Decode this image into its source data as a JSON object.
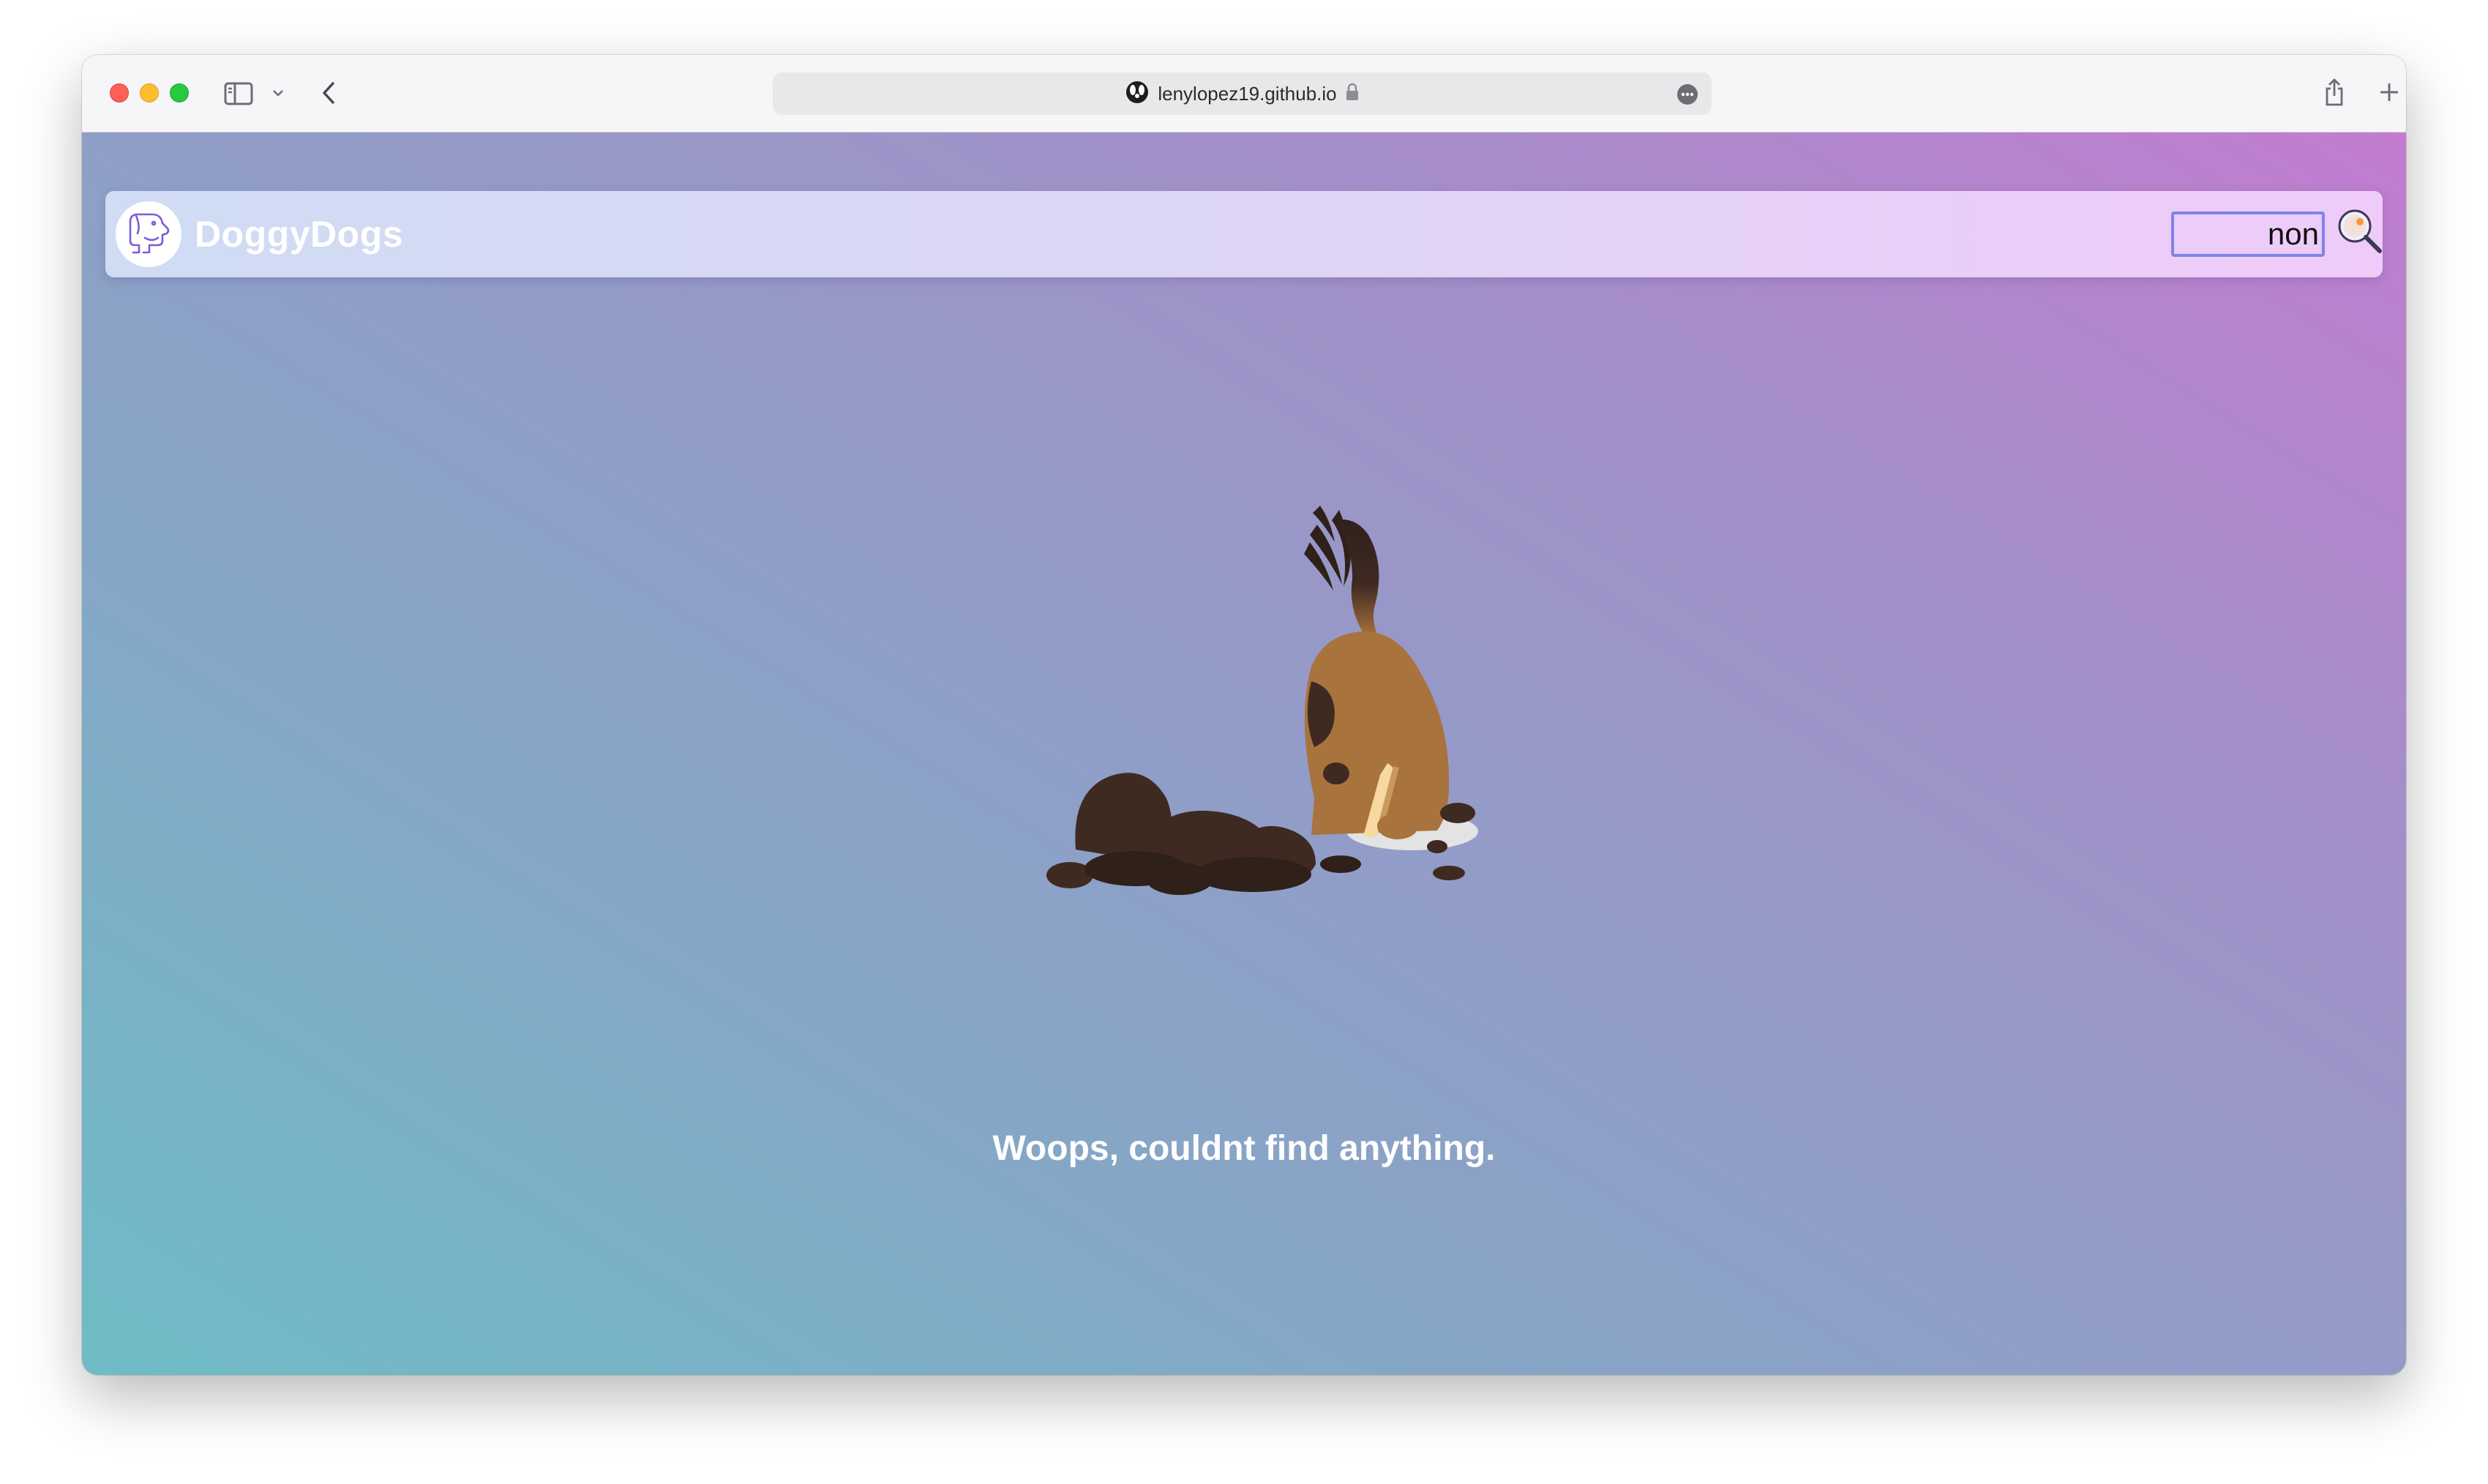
{
  "browser": {
    "url": "lenylopez19.github.io",
    "icons": {
      "sidebar": "sidebar-icon",
      "chevron": "chevron-down-icon",
      "back": "back-icon",
      "site": "site-favicon-icon",
      "lock": "lock-icon",
      "more": "more-icon",
      "share": "share-icon",
      "new_tab": "plus-icon",
      "tabs": "tabs-overview-icon"
    }
  },
  "app": {
    "brand": "DoggyDogs",
    "search": {
      "value": "non",
      "placeholder": ""
    },
    "empty_message": "Woops, couldnt find anything.",
    "colors": {
      "brand_text": "#ffffff",
      "search_border": "#7f84ea",
      "dog_brown": "#a8733d",
      "dirt": "#3f2a22"
    }
  }
}
